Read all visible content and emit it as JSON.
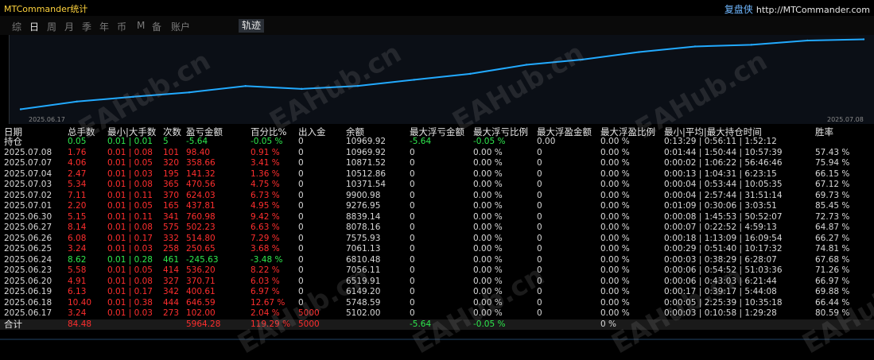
{
  "app": {
    "title": "MTCommander统计",
    "brand_cn": "复盘侠",
    "brand_url": "http://MTCommander.com"
  },
  "tabs": [
    {
      "label": "综",
      "active": false
    },
    {
      "label": "日",
      "active": true
    },
    {
      "label": "周",
      "active": false
    },
    {
      "label": "月",
      "active": false
    },
    {
      "label": "季",
      "active": false
    },
    {
      "label": "年",
      "active": false
    },
    {
      "label": "币",
      "active": false
    },
    {
      "label": "M",
      "active": false
    },
    {
      "label": "备",
      "active": false
    },
    {
      "label": "账户",
      "active": false
    }
  ],
  "track_tab": "轨迹",
  "chart_data": {
    "type": "line",
    "title": "",
    "xlabel": "",
    "ylabel": "",
    "x_start": "2025.06.17",
    "x_end": "2025.07.08",
    "x": [
      "2025.06.17",
      "2025.06.18",
      "2025.06.19",
      "2025.06.20",
      "2025.06.23",
      "2025.06.24",
      "2025.06.25",
      "2025.06.26",
      "2025.06.27",
      "2025.06.30",
      "2025.07.01",
      "2025.07.02",
      "2025.07.03",
      "2025.07.04",
      "2025.07.07",
      "2025.07.08"
    ],
    "values": [
      5102.0,
      5748.59,
      6149.2,
      6519.91,
      7056.11,
      6810.48,
      7061.13,
      7575.93,
      8078.16,
      8839.14,
      9276.95,
      9900.98,
      10371.54,
      10512.86,
      10871.52,
      10969.92
    ],
    "color": "#22aaff",
    "grid": false
  },
  "headers": {
    "date": "日期",
    "total_lots": "总手数",
    "min_max_lots": "最小|大手数",
    "count": "次数",
    "pnl": "盈亏金额",
    "pct": "百分比%",
    "cash": "出入金",
    "balance": "余额",
    "max_float_loss": "最大浮亏金额",
    "max_float_loss_pct": "最大浮亏比例",
    "max_float_profit": "最大浮盈金额",
    "max_float_profit_pct": "最大浮盈比例",
    "hold_time": "最小|平均|最大持仓时间",
    "winrate": "胜率"
  },
  "holding": {
    "date": "持仓",
    "total_lots": "0.05",
    "min_max_lots": "0.01 | 0.01",
    "count": "5",
    "pnl": "-5.64",
    "pct": "-0.05 %",
    "cash": "0",
    "balance": "10969.92",
    "max_float_loss": "-5.64",
    "max_float_loss_pct": "-0.05 %",
    "max_float_profit": "0.00",
    "max_float_profit_pct": "0.00 %",
    "hold_time": "0:13:29 | 0:56:11 | 1:52:12",
    "winrate": ""
  },
  "rows": [
    {
      "date": "2025.07.08",
      "total_lots": "1.76",
      "min_max_lots": "0.01 | 0.08",
      "count": "101",
      "pnl": "98.40",
      "pct": "0.91 %",
      "cash": "0",
      "balance": "10969.92",
      "max_float_loss": "0",
      "max_float_loss_pct": "0.00 %",
      "max_float_profit": "0",
      "max_float_profit_pct": "0.00 %",
      "hold_time": "0:01:44 | 1:50:44 | 10:57:39",
      "winrate": "57.43 %",
      "sign": "pos"
    },
    {
      "date": "2025.07.07",
      "total_lots": "4.06",
      "min_max_lots": "0.01 | 0.05",
      "count": "320",
      "pnl": "358.66",
      "pct": "3.41 %",
      "cash": "0",
      "balance": "10871.52",
      "max_float_loss": "0",
      "max_float_loss_pct": "0.00 %",
      "max_float_profit": "0",
      "max_float_profit_pct": "0.00 %",
      "hold_time": "0:00:02 | 1:06:22 | 56:46:46",
      "winrate": "75.94 %",
      "sign": "pos"
    },
    {
      "date": "2025.07.04",
      "total_lots": "2.47",
      "min_max_lots": "0.01 | 0.03",
      "count": "195",
      "pnl": "141.32",
      "pct": "1.36 %",
      "cash": "0",
      "balance": "10512.86",
      "max_float_loss": "0",
      "max_float_loss_pct": "0.00 %",
      "max_float_profit": "0",
      "max_float_profit_pct": "0.00 %",
      "hold_time": "0:00:13 | 1:04:31 | 6:23:15",
      "winrate": "66.15 %",
      "sign": "pos"
    },
    {
      "date": "2025.07.03",
      "total_lots": "5.34",
      "min_max_lots": "0.01 | 0.08",
      "count": "365",
      "pnl": "470.56",
      "pct": "4.75 %",
      "cash": "0",
      "balance": "10371.54",
      "max_float_loss": "0",
      "max_float_loss_pct": "0.00 %",
      "max_float_profit": "0",
      "max_float_profit_pct": "0.00 %",
      "hold_time": "0:00:04 | 0:53:44 | 10:05:35",
      "winrate": "67.12 %",
      "sign": "pos"
    },
    {
      "date": "2025.07.02",
      "total_lots": "7.11",
      "min_max_lots": "0.01 | 0.11",
      "count": "370",
      "pnl": "624.03",
      "pct": "6.73 %",
      "cash": "0",
      "balance": "9900.98",
      "max_float_loss": "0",
      "max_float_loss_pct": "0.00 %",
      "max_float_profit": "0",
      "max_float_profit_pct": "0.00 %",
      "hold_time": "0:00:04 | 2:57:44 | 31:51:14",
      "winrate": "69.73 %",
      "sign": "pos"
    },
    {
      "date": "2025.07.01",
      "total_lots": "2.20",
      "min_max_lots": "0.01 | 0.05",
      "count": "165",
      "pnl": "437.81",
      "pct": "4.95 %",
      "cash": "0",
      "balance": "9276.95",
      "max_float_loss": "0",
      "max_float_loss_pct": "0.00 %",
      "max_float_profit": "0",
      "max_float_profit_pct": "0.00 %",
      "hold_time": "0:01:09 | 0:30:06 | 3:03:51",
      "winrate": "85.45 %",
      "sign": "pos"
    },
    {
      "date": "2025.06.30",
      "total_lots": "5.15",
      "min_max_lots": "0.01 | 0.11",
      "count": "341",
      "pnl": "760.98",
      "pct": "9.42 %",
      "cash": "0",
      "balance": "8839.14",
      "max_float_loss": "0",
      "max_float_loss_pct": "0.00 %",
      "max_float_profit": "0",
      "max_float_profit_pct": "0.00 %",
      "hold_time": "0:00:08 | 1:45:53 | 50:52:07",
      "winrate": "72.73 %",
      "sign": "pos"
    },
    {
      "date": "2025.06.27",
      "total_lots": "8.14",
      "min_max_lots": "0.01 | 0.08",
      "count": "575",
      "pnl": "502.23",
      "pct": "6.63 %",
      "cash": "0",
      "balance": "8078.16",
      "max_float_loss": "0",
      "max_float_loss_pct": "0.00 %",
      "max_float_profit": "0",
      "max_float_profit_pct": "0.00 %",
      "hold_time": "0:00:07 | 0:22:52 | 4:59:13",
      "winrate": "64.87 %",
      "sign": "pos"
    },
    {
      "date": "2025.06.26",
      "total_lots": "6.08",
      "min_max_lots": "0.01 | 0.17",
      "count": "332",
      "pnl": "514.80",
      "pct": "7.29 %",
      "cash": "0",
      "balance": "7575.93",
      "max_float_loss": "0",
      "max_float_loss_pct": "0.00 %",
      "max_float_profit": "0",
      "max_float_profit_pct": "0.00 %",
      "hold_time": "0:00:18 | 1:13:09 | 16:09:54",
      "winrate": "66.27 %",
      "sign": "pos"
    },
    {
      "date": "2025.06.25",
      "total_lots": "3.24",
      "min_max_lots": "0.01 | 0.03",
      "count": "258",
      "pnl": "250.65",
      "pct": "3.68 %",
      "cash": "0",
      "balance": "7061.13",
      "max_float_loss": "0",
      "max_float_loss_pct": "0.00 %",
      "max_float_profit": "0",
      "max_float_profit_pct": "0.00 %",
      "hold_time": "0:00:29 | 0:51:40 | 10:17:32",
      "winrate": "74.81 %",
      "sign": "pos"
    },
    {
      "date": "2025.06.24",
      "total_lots": "8.62",
      "min_max_lots": "0.01 | 0.28",
      "count": "461",
      "pnl": "-245.63",
      "pct": "-3.48 %",
      "cash": "0",
      "balance": "6810.48",
      "max_float_loss": "0",
      "max_float_loss_pct": "0.00 %",
      "max_float_profit": "0",
      "max_float_profit_pct": "0.00 %",
      "hold_time": "0:00:03 | 0:38:29 | 6:28:07",
      "winrate": "67.68 %",
      "sign": "neg"
    },
    {
      "date": "2025.06.23",
      "total_lots": "5.58",
      "min_max_lots": "0.01 | 0.05",
      "count": "414",
      "pnl": "536.20",
      "pct": "8.22 %",
      "cash": "0",
      "balance": "7056.11",
      "max_float_loss": "0",
      "max_float_loss_pct": "0.00 %",
      "max_float_profit": "0",
      "max_float_profit_pct": "0.00 %",
      "hold_time": "0:00:06 | 0:54:52 | 51:03:36",
      "winrate": "71.26 %",
      "sign": "pos"
    },
    {
      "date": "2025.06.20",
      "total_lots": "4.91",
      "min_max_lots": "0.01 | 0.08",
      "count": "327",
      "pnl": "370.71",
      "pct": "6.03 %",
      "cash": "0",
      "balance": "6519.91",
      "max_float_loss": "0",
      "max_float_loss_pct": "0.00 %",
      "max_float_profit": "0",
      "max_float_profit_pct": "0.00 %",
      "hold_time": "0:00:06 | 0:43:03 | 6:21:44",
      "winrate": "66.97 %",
      "sign": "pos"
    },
    {
      "date": "2025.06.19",
      "total_lots": "6.13",
      "min_max_lots": "0.01 | 0.17",
      "count": "342",
      "pnl": "400.61",
      "pct": "6.97 %",
      "cash": "0",
      "balance": "6149.20",
      "max_float_loss": "0",
      "max_float_loss_pct": "0.00 %",
      "max_float_profit": "0",
      "max_float_profit_pct": "0.00 %",
      "hold_time": "0:00:17 | 0:39:17 | 5:44:08",
      "winrate": "69.88 %",
      "sign": "pos"
    },
    {
      "date": "2025.06.18",
      "total_lots": "10.40",
      "min_max_lots": "0.01 | 0.38",
      "count": "444",
      "pnl": "646.59",
      "pct": "12.67 %",
      "cash": "0",
      "balance": "5748.59",
      "max_float_loss": "0",
      "max_float_loss_pct": "0.00 %",
      "max_float_profit": "0",
      "max_float_profit_pct": "0.00 %",
      "hold_time": "0:00:05 | 2:25:39 | 10:35:18",
      "winrate": "66.44 %",
      "sign": "pos"
    },
    {
      "date": "2025.06.17",
      "total_lots": "3.24",
      "min_max_lots": "0.01 | 0.03",
      "count": "273",
      "pnl": "102.00",
      "pct": "2.04 %",
      "cash": "5000",
      "balance": "5102.00",
      "max_float_loss": "0",
      "max_float_loss_pct": "0.00 %",
      "max_float_profit": "0",
      "max_float_profit_pct": "0.00 %",
      "hold_time": "0:00:03 | 0:10:58 | 1:29:28",
      "winrate": "80.59 %",
      "sign": "pos"
    }
  ],
  "total": {
    "date": "合计",
    "total_lots": "84.48",
    "min_max_lots": "",
    "count": "",
    "pnl": "5964.28",
    "pct": "119.29 %",
    "cash": "5000",
    "balance": "",
    "max_float_loss": "-5.64",
    "max_float_loss_pct": "-0.05 %",
    "max_float_profit": "",
    "max_float_profit_pct": "0 %",
    "hold_time": "",
    "winrate": ""
  },
  "watermark": "EAHub.cn",
  "colors": {
    "positive": "#ff2e2e",
    "negative": "#2ee84d",
    "neutral": "#d8d8d8",
    "title": "#ffd33d",
    "line": "#22aaff"
  }
}
